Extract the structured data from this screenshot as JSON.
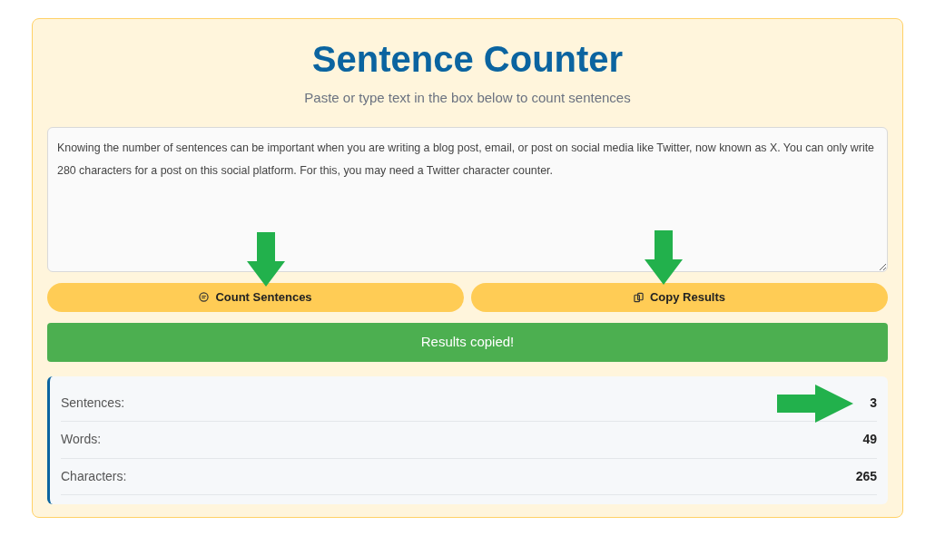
{
  "title": "Sentence Counter",
  "subtitle": "Paste or type text in the box below to count sentences",
  "text_input": {
    "value": "Knowing the number of sentences can be important when you are writing a blog post, email, or post on social media like Twitter, now known as X. You can only write 280 characters for a post on this social platform. For this, you may need a Twitter character counter."
  },
  "buttons": [
    {
      "label": "Count Sentences",
      "arrow": true
    },
    {
      "label": "Copy Results",
      "arrow": true
    }
  ],
  "notice": {
    "text": "Results copied!",
    "kind": "success"
  },
  "stats": [
    {
      "label": "Sentences:",
      "value": "3",
      "arrow": true
    },
    {
      "label": "Words:",
      "value": "49",
      "arrow": false
    },
    {
      "label": "Characters:",
      "value": "265",
      "arrow": false
    }
  ]
}
